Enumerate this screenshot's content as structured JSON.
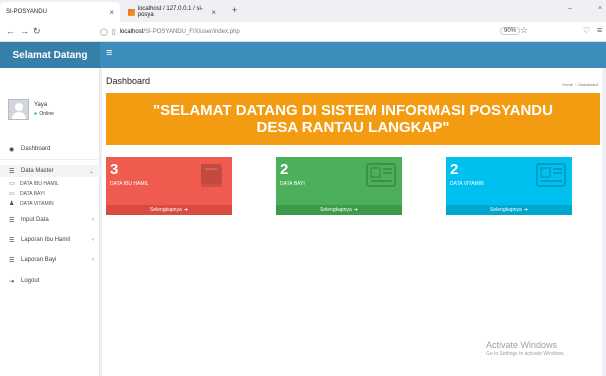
{
  "browser": {
    "tabs": [
      {
        "title": "SI-POSYANDU",
        "active": true
      },
      {
        "title": "localhost / 127.0.0.1 / si-posya"
      }
    ],
    "new_tab_symbol": "+",
    "url_host": "localhost",
    "url_path": "/SI-POSYANDU_FIX/user/index.php",
    "zoom": "90%"
  },
  "app": {
    "brand": "Selamat Datang",
    "hamburger": "≡"
  },
  "user": {
    "name": "Yaya",
    "status": "Online"
  },
  "sidebar": {
    "items": [
      {
        "label": "Dashboard",
        "icon": "dashboard-icon"
      },
      {
        "label": "Data Master",
        "icon": "list-icon",
        "active": true,
        "expanded": true
      },
      {
        "label": "Input Data",
        "icon": "list-icon"
      },
      {
        "label": "Laporan Ibu Hamil",
        "icon": "list-icon"
      },
      {
        "label": "Laporan Bayi",
        "icon": "list-icon"
      },
      {
        "label": "Logout",
        "icon": "signout-icon"
      }
    ],
    "subitems": [
      {
        "label": "DATA IBU HAMIL",
        "icon": "female-icon"
      },
      {
        "label": "DATA BAYI",
        "icon": "baby-icon"
      },
      {
        "label": "DATA VITAMIN",
        "icon": "pill-icon"
      }
    ]
  },
  "content": {
    "title": "Dashboard",
    "breadcrumb": [
      "Home",
      "Dashboard"
    ],
    "banner_line1": "\"SELAMAT DATANG DI SISTEM INFORMASI POSYANDU",
    "banner_line2": "DESA RANTAU LANGKAP\"",
    "boxes": [
      {
        "count": "3",
        "label": "DATA IBU HAMIL",
        "footer": "Selengkapnya",
        "color": "#f05b50",
        "icon": "book-icon"
      },
      {
        "count": "2",
        "label": "DATA BAYI",
        "footer": "Selengkapnya",
        "color": "#4cb05a",
        "icon": "newspaper-icon"
      },
      {
        "count": "2",
        "label": "DATA VITAMIN",
        "footer": "Selengkapnya",
        "color": "#00c0ef",
        "icon": "newspaper-icon"
      }
    ]
  },
  "watermark": {
    "title": "Activate Windows",
    "subtitle": "Go to Settings to activate Windows."
  }
}
